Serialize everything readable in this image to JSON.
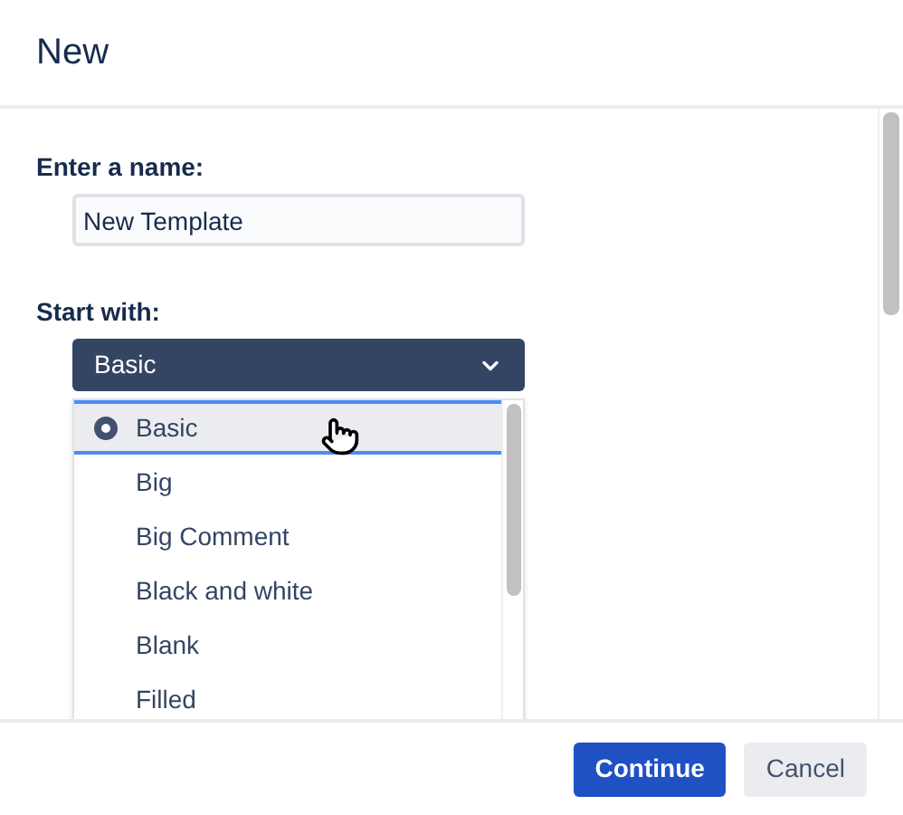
{
  "window": {
    "title": "New"
  },
  "name_field": {
    "label": "Enter a name:",
    "value": "New Template"
  },
  "start_with": {
    "label": "Start with:",
    "value": "Basic",
    "expanded": true,
    "options": [
      {
        "label": "Basic",
        "selected": true
      },
      {
        "label": "Big",
        "selected": false
      },
      {
        "label": "Big Comment",
        "selected": false
      },
      {
        "label": "Black and white",
        "selected": false
      },
      {
        "label": "Blank",
        "selected": false
      },
      {
        "label": "Filled",
        "selected": false
      }
    ]
  },
  "buttons": [
    {
      "label": "Continue",
      "kind": "primary"
    },
    {
      "label": "Cancel",
      "kind": "secondary"
    }
  ]
}
